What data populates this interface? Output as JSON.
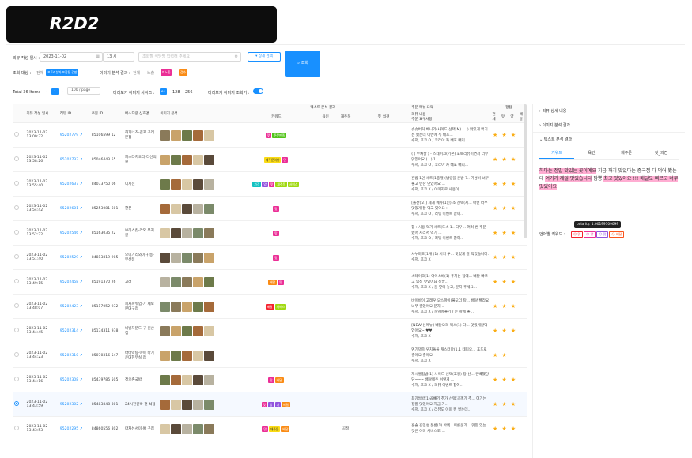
{
  "banner": {
    "title": "R2D2"
  },
  "filters": {
    "date_label": "리뷰 작성 일시 :",
    "date_value": "2023-11-02",
    "hour_value": "13 시",
    "search_placeholder": "조회할 식당명 입력해 주세요",
    "detail_btn": "상세 검색",
    "search_btn": "조회",
    "target_label": "조회 대상 :",
    "target_all": "전체",
    "target_selected": "포토리뷰가 포함된 것만",
    "img_label": "이미지 분석 결과 :",
    "img_all": "전체",
    "img_normal": "노출",
    "img_tag1": "미노출",
    "img_tag2": "검수"
  },
  "toolbar": {
    "total": "Total 36 Items",
    "page_current": "1",
    "page_size": "100 / page",
    "preview_size_label": "미리보기 이미지 사이즈 :",
    "sizes": [
      "64",
      "128",
      "256"
    ],
    "preview_toggle_label": "미리보기 이미지 조회기 :"
  },
  "table": {
    "headers": {
      "date": "리뷰 작성 일시",
      "review_id": "리뷰 ID",
      "order_id": "주문 ID",
      "shop": "배스드랑 상호명",
      "image": "이미지 분석",
      "text_group": "텍스트 분석 결과",
      "keyword": "키워드",
      "taste": "육인",
      "repurchase": "재주문",
      "etc": "첫_의견",
      "review_summary": "주문 메뉴 요약",
      "review_content": "리뷰 내용",
      "review_sub": "주문 요구사항",
      "rating": "평점",
      "r_total": "전체",
      "r_taste": "맛",
      "r_amount": "양",
      "r_delivery": "배달"
    },
    "rows": [
      {
        "date": "2023-11-02 13:09:32",
        "rid": "95202779",
        "oid": "85106599 12",
        "shop": "해피너츠-김포 구래본점",
        "kw": [
          [
            "맛",
            "t-pink"
          ],
          [
            "주문만족",
            "t-green"
          ]
        ],
        "txt": "슈슈버거 베니기(사이드 선택(M) (...) 맛있게 먹기는 했는데 이번에 두 배포...",
        "sub": "수저, 포크 O / 코리아 카 배포 배리...",
        "stars": 3,
        "radio": false
      },
      {
        "date": "2023-11-02 13:58:26",
        "rid": "95202733",
        "oid": "85046443 55",
        "shop": "피스타치오디-디신의원",
        "kw": [
          [
            "재주문의향",
            "t-yellow"
          ],
          [
            "맛",
            "t-pink"
          ]
        ],
        "txt": "( ( 부채살 ) - 스테이크(기본) 포토리뷰이면서 너무 맛있어요 (...) 1",
        ":": "",
        "sub": "수저, 포크 O / 코리아 카 배포 배리...",
        "stars": 3,
        "radio": false
      },
      {
        "date": "2023-11-02 13:55:40",
        "rid": "95202637",
        "oid": "84073750 06",
        "shop": "미지선",
        "kw": [
          [
            "가격",
            "t-cyan"
          ],
          [
            "양",
            "t-purple"
          ],
          [
            "맛",
            "t-pink"
          ],
          [
            "재주문",
            "t-lime"
          ],
          [
            "서비스",
            "t-lime"
          ]
        ],
        "txt": "혼밥 1인 세트(1종밥)(밥량을 준밥 7.. 가성비 너무 좋고 반찬 맛있어요 ...",
        "sub": "수저, 포크 X / 이미지로 사용이...",
        "stars": 3,
        "radio": false
      },
      {
        "date": "2023-11-02 13:54:42",
        "rid": "95202601",
        "oid": "85253081 601",
        "shop": "한분",
        "kw": [
          [
            "맛",
            "t-pink"
          ]
        ],
        "txt": "[돌잔(오)] 세계 메뉴(1인) 소 선택(세... 매번 너무 맛있게 잘 먹고 있어요 :)",
        "sub": "수저, 포크 O / 리뷰 이벤트 참여...",
        "stars": 3,
        "radio": false
      },
      {
        "date": "2023-11-02 13:52:22",
        "rid": "95202546",
        "oid": "85163035 22",
        "shop": "브리스킷-라외 부지원",
        "kw": [
          [
            "맛",
            "t-pink"
          ]
        ],
        "txt": "힘 : 사용 먹기 세트(도스 1.. 다우... 여러 번 주문했어 저러서 먹기 ...",
        "sub": "수저, 포크 O / 리뷰 이벤트 참여...",
        "stars": 3,
        "radio": false
      },
      {
        "date": "2023-11-02 13:51:40",
        "rid": "95202529",
        "oid": "84813819 905",
        "shop": "오니기리와이규 동-부산점",
        "kw": [
          [
            "맛",
            "t-pink"
          ]
        ],
        "txt": "사누마토(1개 (1) 서치 투... 맛있게 잘 먹었습니다.",
        "sub": "수저, 포크 X",
        "stars": 3,
        "radio": false
      },
      {
        "date": "2023-11-02 13:49:15",
        "rid": "95202458",
        "oid": "85191370 26",
        "shop": "고래",
        "kw": [
          [
            "배달",
            "t-orange"
          ],
          [
            "맛",
            "t-pink"
          ]
        ],
        "txt": "스테이크(1) 아이스바(1) 퓨처는 집에... 배달 빠르고 엄청 맛있어요 정말...",
        "sub": "수저, 포크 X / 문 앞에 놓고, 문자 주세요...",
        "stars": 3,
        "radio": false
      },
      {
        "date": "2023-11-02 13:48:07",
        "rid": "95202423",
        "oid": "85117052 932",
        "shop": "피자파워업-기 제보본대구점",
        "kw": [
          [
            "배달",
            "t-red"
          ],
          [
            "서비스",
            "t-lime"
          ]
        ],
        "txt": "바이바이 고래우 오스파이(풀오더 탕... 배달 빨라요 너무 좋았어요 문자...",
        "sub": "수저, 포크 X / 문앞에놓기 / 문 앞에 놓...",
        "stars": 3,
        "radio": false
      },
      {
        "date": "2023-11-02 13:44:45",
        "rid": "95202314",
        "oid": "85174311 938",
        "shop": "비닐처분드-구 원산점",
        "kw": [],
        "txt": "[NEW 신메뉴] 배달오리 맥스(1) 다... 맛있게잘먹었어요~ ♥♥",
        "sub": "수저, 포크 X",
        "stars": 3,
        "radio": false
      },
      {
        "date": "2023-11-02 13:44:23",
        "rid": "95202310",
        "oid": "85070316 547",
        "shop": "바바막탕-야야 바거운대현무실 점",
        "kw": [],
        "txt": "명기댕중 우치돌을 캐스터마(1.1 테디오... 포도로 좋아요 좋아요",
        "sub": "수저, 포크 X",
        "stars": 2,
        "radio": false
      },
      {
        "date": "2023-11-02 13:44:16",
        "rid": "95202308",
        "oid": "85439785 505",
        "shop": "정오존국밥",
        "kw": [
          [
            "맛",
            "t-pink"
          ],
          [
            "배달",
            "t-orange"
          ]
        ],
        "txt": "제시엘집밥(1) 사이드 선택(포몽) 탕 선... 완벽했당당~~~ 배달메주 이렇게 ...",
        "sub": "수저, 포크 X / 리뷰 이벤트 참여...",
        "stars": 3,
        "radio": false
      },
      {
        "date": "2023-11-02 13:43:59",
        "rid": "95202302",
        "oid": "85483848 801",
        "shop": "24시전원박-천 석점",
        "kw": [
          [
            "맛",
            "t-pink"
          ],
          [
            "양",
            "t-purple"
          ],
          [
            "가",
            "t-purple"
          ],
          [
            "배달",
            "t-orange"
          ]
        ],
        "txt": "최강쌈밥(1)곱빼기 추가 선택(공깨기 추... 여기는 정말 맛있어요 지금 가...",
        "sub": "수저, 포크 X / 리뷰도 이미 뭐 썼는데...",
        "stars": 3,
        "radio": true
      },
      {
        "date": "2023-11-02 13:43:53",
        "rid": "95202295",
        "oid": "84860556 802",
        "shop": "마차는서미-통 구점",
        "kw": [
          [
            "맛",
            "t-pink"
          ],
          [
            "재주문",
            "t-yellow"
          ],
          [
            "배달",
            "t-orange"
          ]
        ],
        "txt": "훈솔 김민성 둠룸(1) 바넷 | 이륜운기... 맛만 있는 것은 이미 서비스도 ...",
        "sub": "",
        "repurchase": "공정",
        "stars": 3,
        "radio": false
      }
    ]
  },
  "panel": {
    "acc1": "리뷰 상세 내용",
    "acc2": "이미지 분석 결과",
    "acc3": "텍스트 분석 결과",
    "tabs": [
      "키워드",
      "육인",
      "재주문",
      "첫_의견"
    ],
    "text_hl1": "하다는 정말 맛있는 곳이예요",
    "text_plain1": " 지금 까지 맛있다는 중국집 다 먹어 봤는데 ",
    "text_hl2": "여기가 제일 맛있습니다",
    "text_plain2": " 짬뽕 ",
    "text_hl3": "최고 맛있어요 !!! 배달도 빠르고 너무 맛있어요 ",
    "tooltip": "polarity: 1.00199709099",
    "keywords_label": "언어별 키워드 :",
    "sentiments": [
      "맛",
      "양",
      "맛",
      "배달"
    ]
  },
  "colors": {
    "primary": "#1890ff",
    "star": "#faad14",
    "banner": "#0d0d0d"
  }
}
